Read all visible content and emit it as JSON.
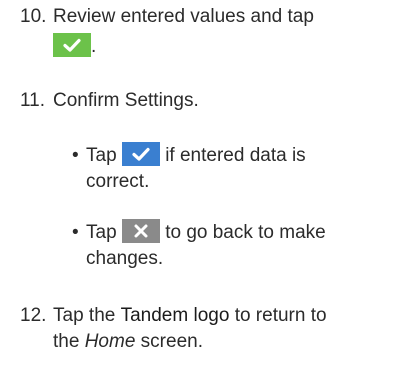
{
  "step10": {
    "number": "10.",
    "text_before": "Review entered values and tap",
    "text_after": ".",
    "icon": "check-icon",
    "icon_bg": "#6cc24a"
  },
  "step11": {
    "number": "11.",
    "text": "Confirm Settings.",
    "bullets": [
      {
        "dot": "•",
        "before": "Tap",
        "after_line1": "if entered data is",
        "after_line2": "correct.",
        "icon": "check-icon",
        "icon_bg": "#3a7fd0"
      },
      {
        "dot": "•",
        "before": "Tap",
        "after_line1": "to go back to make",
        "after_line2": "changes.",
        "icon": "close-icon",
        "icon_bg": "#8a8a8a"
      }
    ]
  },
  "step12": {
    "number": "12.",
    "before": "Tap the",
    "bold": "Tandem logo",
    "after_line1": "to return to",
    "line2_before": "the",
    "line2_italic": "Home",
    "line2_after": "screen."
  }
}
